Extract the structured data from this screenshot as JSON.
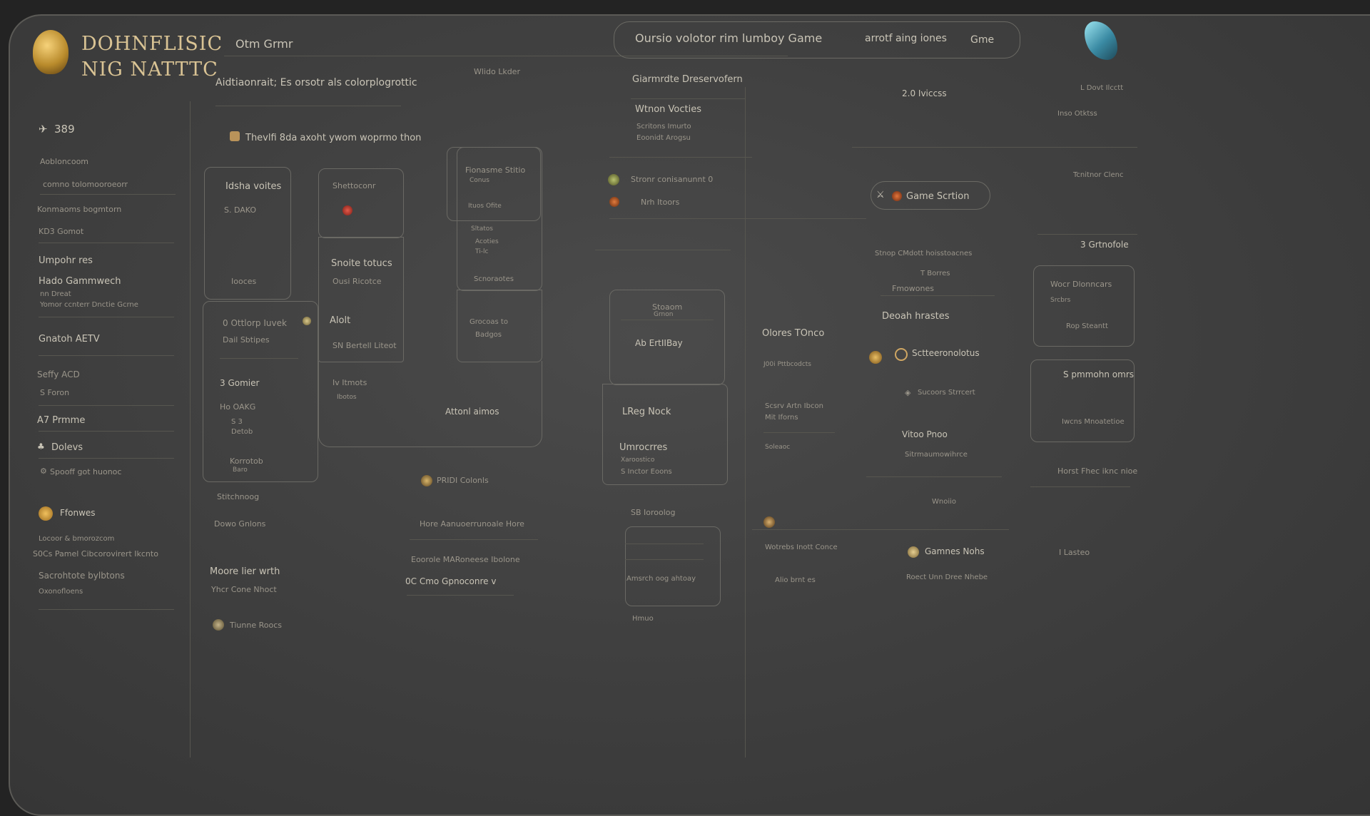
{
  "brand": {
    "title_line1": "DOHNFLISIC",
    "title_line2": "NIG  NATTTC"
  },
  "topbar": {
    "nav_left": "Otm Grmr",
    "headline": "Oursio volotor rim lumboy Game",
    "right_link": "arrotf aing iones",
    "game_btn": "Gme"
  },
  "left_nav": {
    "count": "389",
    "items": [
      {
        "label": "Aobloncoom"
      },
      {
        "label": "comno tolomooroeorr"
      },
      {
        "label": "Konmaoms bogmtorn"
      },
      {
        "label": "KD3 Gomot"
      },
      {
        "label": "Umpohr res"
      },
      {
        "label": "Hado Gammwech"
      },
      {
        "label": "nn Dreat"
      },
      {
        "label": "Yomor ccnterr Dnctie Gcrne"
      },
      {
        "label": "Gnatoh AETV"
      },
      {
        "label": "Seffy ACD"
      },
      {
        "label": "S Foron"
      },
      {
        "label": "A7 Prmme"
      },
      {
        "label": "Dolevs"
      },
      {
        "label": "Spooff got huonoc"
      },
      {
        "label": "Ffonwes"
      },
      {
        "label": "Locoor & bmorozcom"
      },
      {
        "label": "S0Cs Pamel Cibcorovirert Ikcnto"
      },
      {
        "label": "Sacrohtote bylbtons"
      },
      {
        "label": "Oxonofloens"
      }
    ]
  },
  "center": {
    "subtitle": "Aidtiaonrait; Es orsotr als colorplogrottic",
    "hint": "Thevlfi 8da axoht ywom woprmo thon",
    "top_mid_label": "Wlido Lkder",
    "card1": {
      "title": "Idsha voites",
      "sub": "S. DAKO",
      "foot": "Iooces"
    },
    "card2": {
      "title": "Shettoconr",
      "mid_title": "Snoite totucs",
      "mid_sub": "Ousi Ricotce",
      "lower_title": "Alolt",
      "lower_sub": "SN Bertell Liteot"
    },
    "card3": {
      "title": "Fionasme Stitio",
      "sub": "Conus",
      "row1": "Ituos Ofite",
      "row2": "Sltatos",
      "row3": "Acoties",
      "row4": "Ti-lc",
      "foot": "Scnoraotes",
      "row5": "Grocoas to",
      "row6": "Badgos"
    },
    "card4": {
      "title": "0 Ottlorp Iuvek",
      "sub": "Dail Sbtipes",
      "t2": "3 Gomier",
      "t3": "Ho OAKG",
      "t4": "S 3",
      "t5": "Detob",
      "t6": "Korrotob",
      "t7": "Baro"
    },
    "lower": {
      "row_a": "Iv Itmots",
      "row_b": "Ibotos",
      "center_label": "Attonl aimos",
      "pin_label": "PRIDI Colonls",
      "stroke": "Stitchnoog",
      "stroke2": "Dowo Gnlons",
      "hore": "Hore Aanuoerrunoale Hore",
      "focus": "Eoorole MARoneese Ibolone",
      "dc": "0C Cmo Gpnoconre v",
      "more": "Moore lier wrth",
      "more_sub": "Yhcr Cone Nhoct",
      "bottom": "Tiunne Roocs"
    }
  },
  "middle_right": {
    "section_title": "Giarmrdte Dreservofern",
    "item1_title": "Wtnon Vocties",
    "item1_sub1": "Scritons Imurto",
    "item1_sub2": "Eoonidt Arogsu",
    "pin1": "Stronr conisanunnt 0",
    "pin2": "Nrh Itoors",
    "card_title": "Stoaom",
    "card_sub": "Grnon",
    "card_row": "Ab ErtIIBay",
    "lower_title": "LReg Nock",
    "u_title": "Umrocrres",
    "u_sub": "Xaroostico",
    "u_row": "S Inctor Eoons",
    "sbooutg": "SB Ioroolog",
    "mid_item": "Amsrch oog ahtoay",
    "bottom": "Hmuo"
  },
  "right_col": {
    "count": "2.0 Iviccss",
    "game_section": "Game Scrtion",
    "rows": [
      "Stnop CMdott hoisstoacnes",
      "T Borres",
      "Fmowones",
      "Deoah hrastes"
    ],
    "glory": "Olores TOnco",
    "glory_sub": "J00i Pttbcodcts",
    "st": "Sctteeronolotus",
    "sh": "Sucoors Strrcert",
    "sx": "Scsrv Artn Ibcon",
    "sx2": "Mit Iforns",
    "sx3": "Soleaoc",
    "vitro": "Vitoo Pnoo",
    "vitro_sub": "Sitrmaumowihrce",
    "worn": "Wnoiio",
    "worn2": "Wotrebs Inott Conce",
    "worn3": "Alio brnt es",
    "gamnes": "Gamnes Nohs",
    "gamnes_sub": "Roect Unn Dree Nhebe",
    "far": {
      "a": "L Dovt Ilcctt",
      "b": "Inso Otktss",
      "c": "Tcnitnor Clenc",
      "d": "3 Grtnofole",
      "e": "Wocr Dlonncars",
      "f": "Srcbrs",
      "g": "Rop Steantt",
      "h": "S pmmohn omrs",
      "i": "Iwcns Mnoatetioe",
      "j": "Horst Fhec iknc nioe",
      "k": "I Lasteo"
    }
  }
}
